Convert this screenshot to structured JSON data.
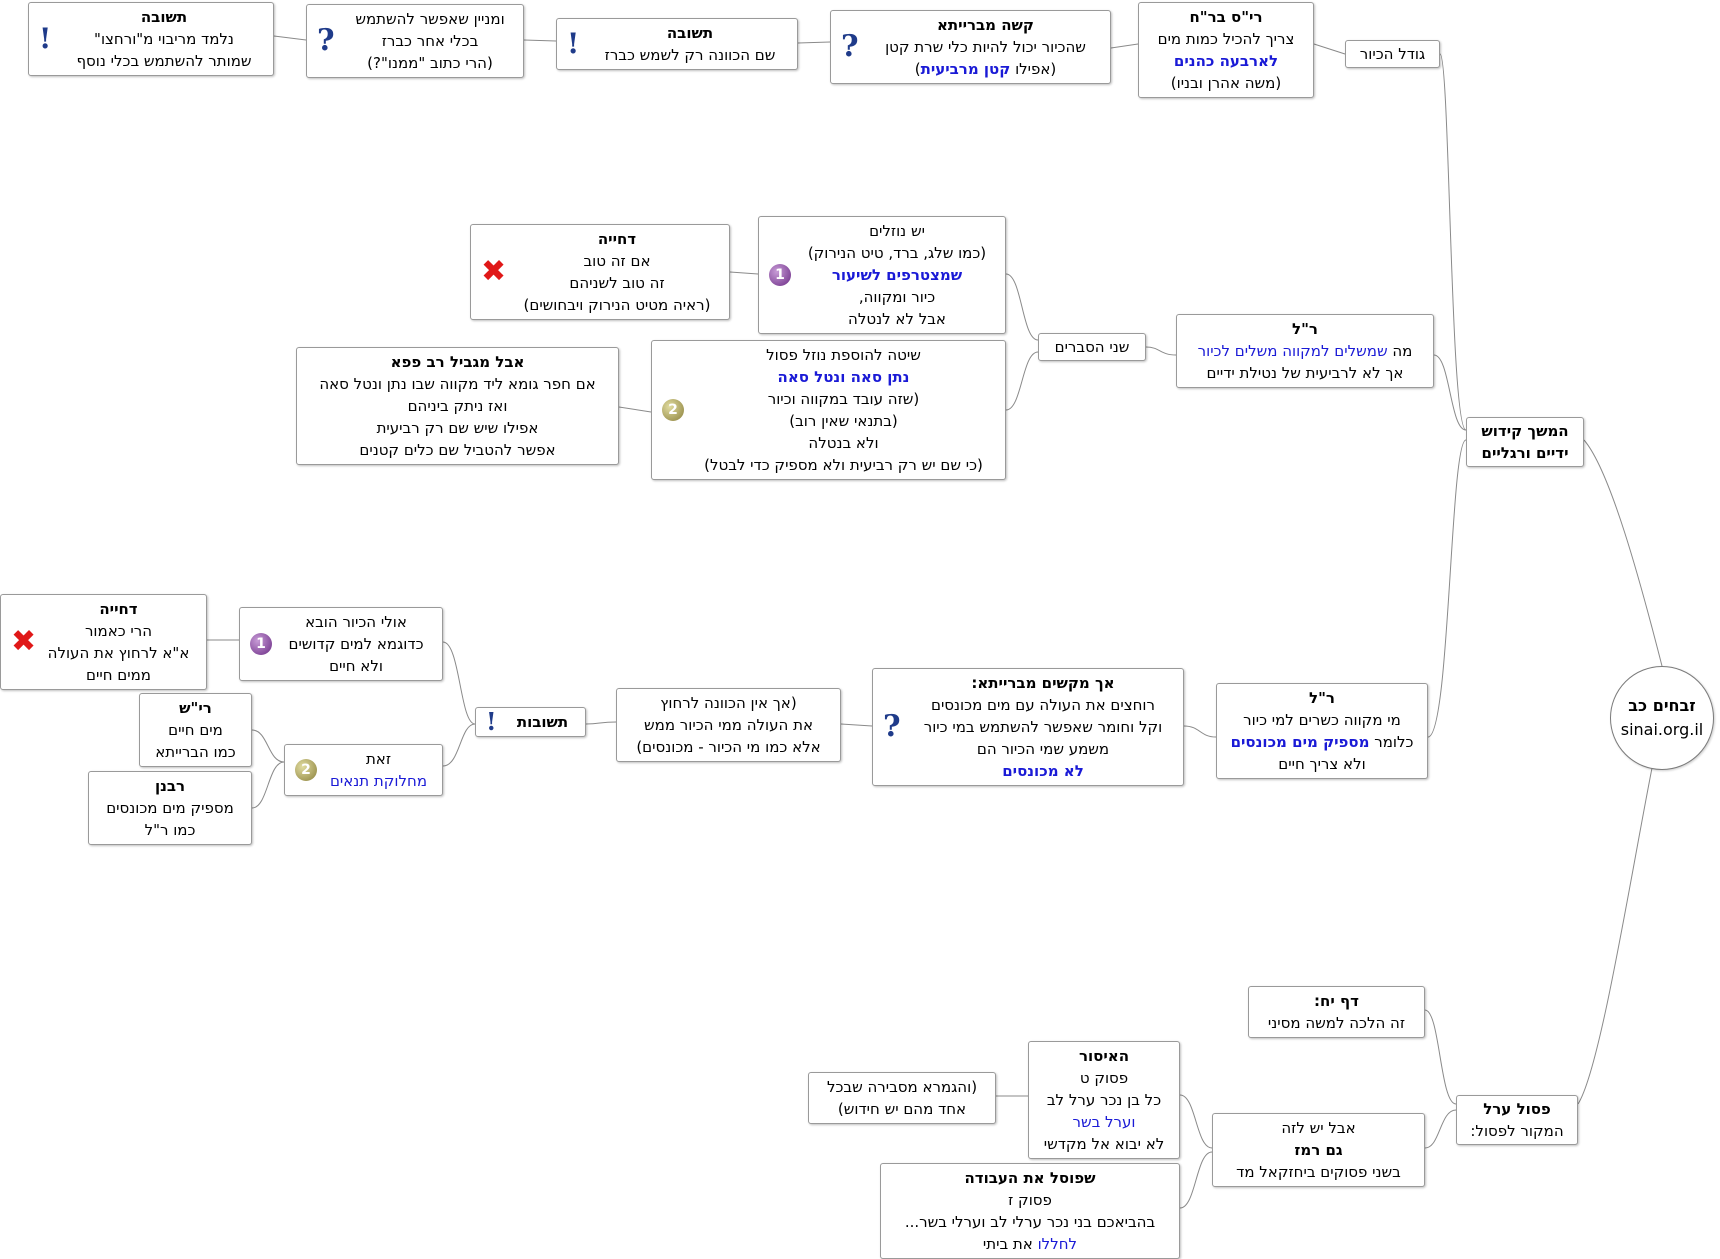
{
  "root": {
    "title": "זבחים כב",
    "site": "sinai.org.il"
  },
  "branch_hemshech": {
    "l1": "המשך קידוש",
    "l2": "ידיים ורגליים"
  },
  "branch_pasul": {
    "title": "פסול ערל",
    "l2": "המקור לפסול:"
  },
  "godel": {
    "label": "גודל הכיור"
  },
  "rish_brach": {
    "title": "רי\"ס בר\"ח",
    "l1": "צריך להכיל כמות מים",
    "l2": "לארבעה כהנים",
    "l3": "(משה אהרן ובניו)"
  },
  "kasha": {
    "title": "קשה מברייתא",
    "l1": "שהכיור יכול להיות כלי שרת קטן",
    "l2a": "(אפילו ",
    "l2b": "קטן מרביעית",
    "l2c": ")"
  },
  "teshuva1": {
    "title": "תשובה",
    "l1": "שם הכוונה רק לשמש כברז"
  },
  "minayin": {
    "l1": "ומניין שאפשר להשתמש",
    "l2": "בכלי אחר כברז",
    "l3": "(הרי כתוב \"ממנו\"?)"
  },
  "teshuva2": {
    "title": "תשובה",
    "l1": "נלמד מריבוי מ\"ורחצו\"",
    "l2": "שמותר להשתמש בכלי נוסף"
  },
  "rl1": {
    "title": "ר\"ל",
    "l1a": "מה ",
    "l1b": "שמשלים למקווה משלים לכיור",
    "l2": "אך לא לרביעית של נטילת ידיים"
  },
  "shnei": {
    "label": "שני הסברים"
  },
  "yesh_nozlim": {
    "l1": "יש נוזלים",
    "l2": "(כמו שלג, ברד, טיט הנירוק)",
    "l3": "שמצטרפים לשיעור",
    "l4": "כיור ומקווה,",
    "l5": "אבל לא לנטלה",
    "num": "1"
  },
  "dchiya1": {
    "title": "דחייה",
    "l1": "אם זה טוב",
    "l2": "זה טוב לשניהם",
    "l3": "(ראיה מטיט הנירוק ויבחושים)"
  },
  "shita": {
    "l1": "שיטה להוספת נוזל פסול",
    "l2": "נתן סאה ונטל סאה",
    "l3": "(שזה עובד במקווה וכיור",
    "l4": "(בתנאי שאין רוב)",
    "l5": "ולא בנטלה",
    "l6": "(כי שם יש רק רביעית ולא מספיק כדי לבטל)",
    "num": "2"
  },
  "aval": {
    "title": "אבל מגביל רב פפא",
    "l1": "אם חפר גומא ליד מקווה שבו נתן ונטל סאה",
    "l2": "ואז ניתק ביניהם",
    "l3": "אפילו שיש שם רק רביעית",
    "l4": "אפשר להטביל שם כלים קטנים"
  },
  "rl2": {
    "title": "ר\"ל",
    "l1": "מי מקווה כשרים למי כיור",
    "l2a": "כלומר ",
    "l2b": "מספיק מים מכונסים",
    "l3": "ולא צריך חיים"
  },
  "ach": {
    "title": "אך מקשים מברייתא:",
    "l1": "רוחצים את העולה עם מים מכונסים",
    "l2": "וקל וחומר שאפשר להשתמש במי כיור",
    "l3": "משמע שמי הכיור הם",
    "l4": "לא מכונסים"
  },
  "ein": {
    "l1": "(אך אין הכוונה לרחוץ",
    "l2": "את העולה ממי הכיור ממש",
    "l3": "אלא כמו מי הכיור - מכונסים)"
  },
  "teshuvot": {
    "title": "תשובות"
  },
  "ulai": {
    "l1": "אולי הכיור הובא",
    "l2": "כדוגמא למים קדושים",
    "l3": "ולא חיים",
    "num": "1"
  },
  "dchiya2": {
    "title": "דחייה",
    "l1": "הרי כאמור",
    "l2": "א\"א לרחוץ את העולה",
    "l3": "ממים חיים"
  },
  "zot": {
    "l1": "זאת",
    "l2": "מחלוקת תנאים",
    "num": "2"
  },
  "rish": {
    "title": "רי\"ש",
    "l1": "מים חיים",
    "l2": "כמו הברייתא"
  },
  "rabanan": {
    "title": "רבנן",
    "l1": "מספיק מים מכונסים",
    "l2": "כמו ר\"ל"
  },
  "daf": {
    "title": "דף יח:",
    "l1": "זה הלכה למשה מסיני"
  },
  "aval_yesh": {
    "l1": "אבל יש לזה",
    "l2": "גם רמז",
    "l3": "בשני  פסוקים ביחזקאל מד"
  },
  "isur": {
    "title": "האיסור",
    "l1": "פסוק ט",
    "l2": "כל בן נכר ערל לב",
    "l3": "וערל בשר",
    "l4": "לא יבוא אל מקדשי"
  },
  "gemara": {
    "l1": "(והגמרא מסבירה שבכל",
    "l2": "אחד מהם יש חידוש)"
  },
  "shepasul": {
    "title": "שפוסל את העבודה",
    "l1": "פסוק ז",
    "l2": "בהביאכם בני נכר ערלי לב וערלי בשר...",
    "l3a": "לחללו",
    "l3b": " את ביתי"
  },
  "colors": {
    "link_blue": "#1a1ad6",
    "connector": "#8a8a8a",
    "question_icon": "#1f3b8a",
    "reject_icon": "#e01818"
  }
}
